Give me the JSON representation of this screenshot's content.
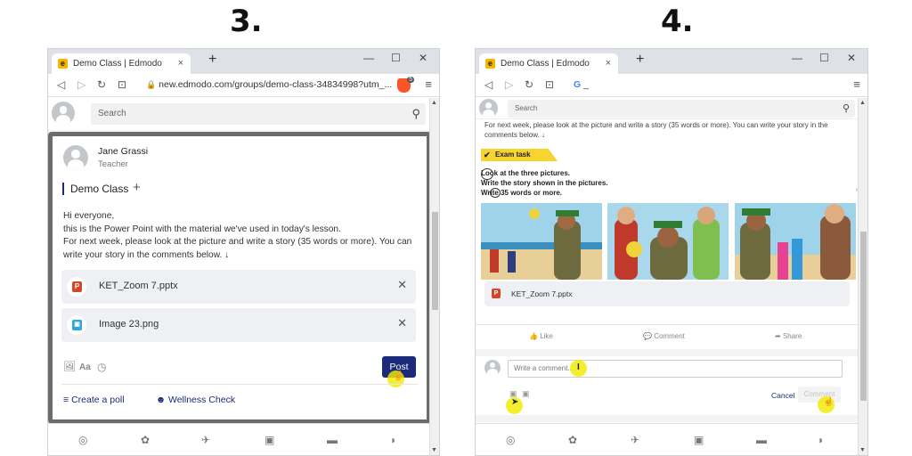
{
  "steps": {
    "left": "3.",
    "right": "4."
  },
  "browser": {
    "tab_title": "Demo Class | Edmodo",
    "tab_close": "×",
    "favicon": "e",
    "new_tab": "+",
    "window_controls": [
      "—",
      "☐",
      "✕"
    ],
    "nav_icons": [
      "◁",
      "▷",
      "↻",
      "⊡"
    ],
    "lock_icon": "🔒",
    "url_left": "new.edmodo.com/groups/demo-class-34834998?utm_...",
    "url_right": "_",
    "google_g": "G",
    "menu_icon": "≡",
    "brave_badge": "5"
  },
  "left": {
    "search_placeholder": "Search",
    "author": "Jane Grassi",
    "role": "Teacher",
    "group": "Demo Class",
    "group_add": "+",
    "body_lines": [
      "Hi everyone,",
      "this is the Power Point with the material we've used in today's lesson.",
      "For next week, please look at the picture and write a story (35 words or more). You can",
      "write your story in the comments below.  ↓"
    ],
    "attachments": [
      {
        "name": "KET_Zoom 7.pptx",
        "icon": "P",
        "color": "#d24726"
      },
      {
        "name": "Image 23.png",
        "icon": "▣",
        "color": "#2aa7e0"
      }
    ],
    "remove": "✕",
    "tools": [
      "🖼",
      "Aa",
      "◷"
    ],
    "post_label": "Post",
    "poll_label": "Create a poll",
    "wellness_label": "Wellness Check",
    "poll_icon": "≡",
    "wellness_icon": "☻"
  },
  "right": {
    "search_placeholder": "Search",
    "top_text": [
      "For next week, please look at the picture and write a story (35 words or more). You can write your story in the",
      "comments below.  ↓"
    ],
    "exam_badge": "Exam task",
    "exam_lines": [
      "Look at the three pictures.",
      "Write the story shown in the pictures.",
      "Write 35 words or more."
    ],
    "attachment": "KET_Zoom 7.pptx",
    "attachment_icon": "P",
    "like": "Like",
    "comment": "Comment",
    "share": "Share",
    "like_icon": "👍",
    "comment_icon": "💬",
    "share_icon": "➦",
    "comment_placeholder": "Write a comment...",
    "text_cursor": "I",
    "cancel": "Cancel",
    "submit": "Comment"
  },
  "bottom_icons": [
    "◎",
    "✿",
    "✈",
    "▣",
    "▬",
    "◗"
  ],
  "colors": {
    "accent": "#1b2a7a",
    "highlight": "#f0ec00",
    "edmodo_yellow": "#f4b600",
    "exam_yellow": "#f6d531"
  }
}
